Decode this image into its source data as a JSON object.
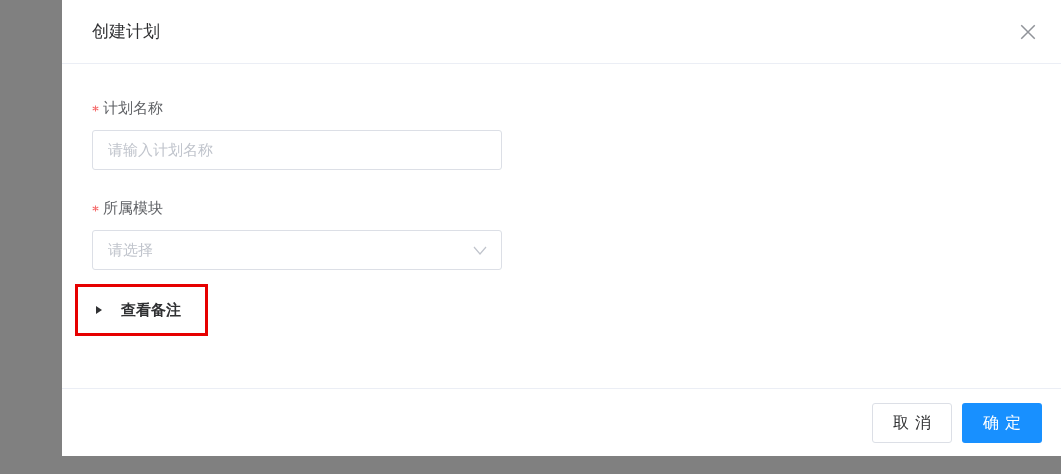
{
  "dialog": {
    "title": "创建计划"
  },
  "fields": [
    {
      "kind": "input",
      "label": "计划名称",
      "required": true,
      "placeholder": "请输入计划名称"
    },
    {
      "kind": "select",
      "label": "所属模块",
      "required": true,
      "placeholder": "请选择"
    }
  ],
  "collapse": {
    "label": "查看备注",
    "expanded": false
  },
  "buttons": [
    {
      "label": "取 消",
      "kind": "default"
    },
    {
      "label": "确 定",
      "kind": "primary"
    }
  ]
}
